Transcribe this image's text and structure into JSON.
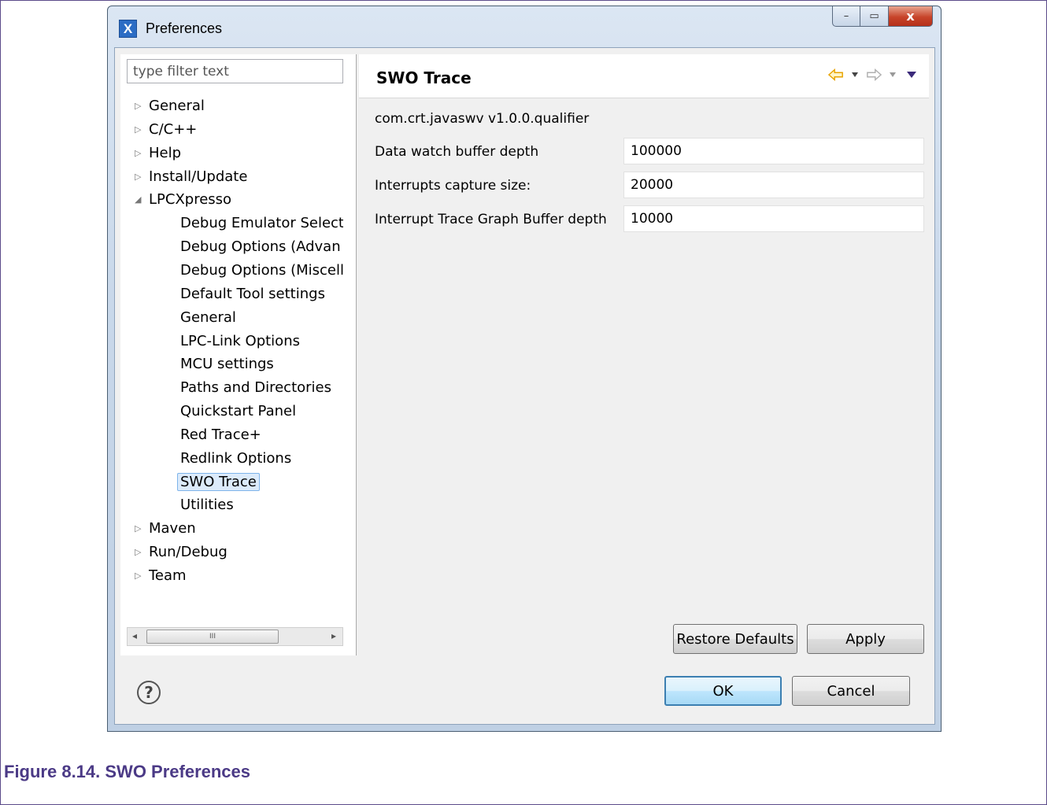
{
  "window": {
    "title": "Preferences",
    "icon": "x-app-icon",
    "controls": {
      "minimize": "–",
      "maximize": "▭",
      "close": "x"
    }
  },
  "filter": {
    "placeholder": "type filter text",
    "value": ""
  },
  "tree": [
    {
      "label": "General",
      "level": 0,
      "expander": "▷"
    },
    {
      "label": "C/C++",
      "level": 0,
      "expander": "▷"
    },
    {
      "label": "Help",
      "level": 0,
      "expander": "▷"
    },
    {
      "label": "Install/Update",
      "level": 0,
      "expander": "▷"
    },
    {
      "label": "LPCXpresso",
      "level": 0,
      "expander": "◢"
    },
    {
      "label": "Debug Emulator Selecti",
      "level": 1
    },
    {
      "label": "Debug Options (Advan",
      "level": 1
    },
    {
      "label": "Debug Options (Miscell",
      "level": 1
    },
    {
      "label": "Default Tool settings",
      "level": 1
    },
    {
      "label": "General",
      "level": 1
    },
    {
      "label": "LPC-Link Options",
      "level": 1
    },
    {
      "label": "MCU settings",
      "level": 1
    },
    {
      "label": "Paths and Directories",
      "level": 1
    },
    {
      "label": "Quickstart Panel",
      "level": 1
    },
    {
      "label": "Red Trace+",
      "level": 1
    },
    {
      "label": "Redlink Options",
      "level": 1
    },
    {
      "label": "SWO Trace",
      "level": 1,
      "selected": true
    },
    {
      "label": "Utilities",
      "level": 1
    },
    {
      "label": "Maven",
      "level": 0,
      "expander": "▷"
    },
    {
      "label": "Run/Debug",
      "level": 0,
      "expander": "▷"
    },
    {
      "label": "Team",
      "level": 0,
      "expander": "▷"
    }
  ],
  "scrollbar": {
    "left": "◂",
    "right": "▸",
    "grip": "III"
  },
  "page": {
    "title": "SWO Trace",
    "plugin_id": "com.crt.javaswv v1.0.0.qualifier",
    "fields": [
      {
        "label": "Data watch buffer depth",
        "value": "100000"
      },
      {
        "label": "Interrupts capture size:",
        "value": "20000"
      },
      {
        "label": "Interrupt Trace Graph Buffer depth",
        "value": "10000"
      }
    ],
    "restore_defaults": "Restore Defaults",
    "apply": "Apply"
  },
  "buttons": {
    "help": "?",
    "ok": "OK",
    "cancel": "Cancel"
  },
  "caption": "Figure 8.14. SWO Preferences",
  "colors": {
    "accent": "#4b3a86",
    "nav_back": "#e8a300",
    "selection": "#dcebfb"
  }
}
